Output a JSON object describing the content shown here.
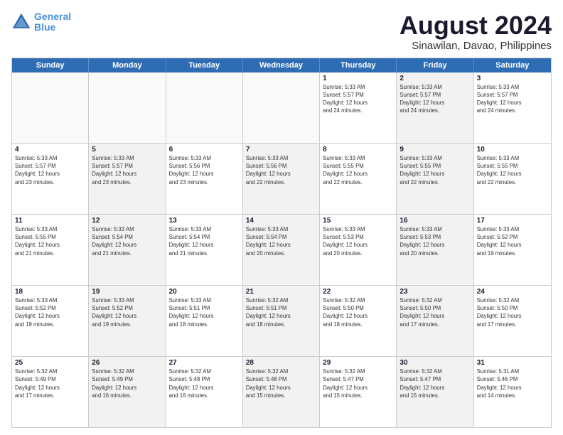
{
  "logo": {
    "line1": "General",
    "line2": "Blue"
  },
  "title": "August 2024",
  "subtitle": "Sinawilan, Davao, Philippines",
  "header_days": [
    "Sunday",
    "Monday",
    "Tuesday",
    "Wednesday",
    "Thursday",
    "Friday",
    "Saturday"
  ],
  "weeks": [
    [
      {
        "day": "",
        "info": "",
        "empty": true
      },
      {
        "day": "",
        "info": "",
        "empty": true
      },
      {
        "day": "",
        "info": "",
        "empty": true
      },
      {
        "day": "",
        "info": "",
        "empty": true
      },
      {
        "day": "1",
        "info": "Sunrise: 5:33 AM\nSunset: 5:57 PM\nDaylight: 12 hours\nand 24 minutes.",
        "empty": false,
        "shaded": false
      },
      {
        "day": "2",
        "info": "Sunrise: 5:33 AM\nSunset: 5:57 PM\nDaylight: 12 hours\nand 24 minutes.",
        "empty": false,
        "shaded": true
      },
      {
        "day": "3",
        "info": "Sunrise: 5:33 AM\nSunset: 5:57 PM\nDaylight: 12 hours\nand 24 minutes.",
        "empty": false,
        "shaded": false
      }
    ],
    [
      {
        "day": "4",
        "info": "Sunrise: 5:33 AM\nSunset: 5:57 PM\nDaylight: 12 hours\nand 23 minutes.",
        "empty": false,
        "shaded": false
      },
      {
        "day": "5",
        "info": "Sunrise: 5:33 AM\nSunset: 5:57 PM\nDaylight: 12 hours\nand 23 minutes.",
        "empty": false,
        "shaded": true
      },
      {
        "day": "6",
        "info": "Sunrise: 5:33 AM\nSunset: 5:56 PM\nDaylight: 12 hours\nand 23 minutes.",
        "empty": false,
        "shaded": false
      },
      {
        "day": "7",
        "info": "Sunrise: 5:33 AM\nSunset: 5:56 PM\nDaylight: 12 hours\nand 22 minutes.",
        "empty": false,
        "shaded": true
      },
      {
        "day": "8",
        "info": "Sunrise: 5:33 AM\nSunset: 5:55 PM\nDaylight: 12 hours\nand 22 minutes.",
        "empty": false,
        "shaded": false
      },
      {
        "day": "9",
        "info": "Sunrise: 5:33 AM\nSunset: 5:55 PM\nDaylight: 12 hours\nand 22 minutes.",
        "empty": false,
        "shaded": true
      },
      {
        "day": "10",
        "info": "Sunrise: 5:33 AM\nSunset: 5:55 PM\nDaylight: 12 hours\nand 22 minutes.",
        "empty": false,
        "shaded": false
      }
    ],
    [
      {
        "day": "11",
        "info": "Sunrise: 5:33 AM\nSunset: 5:55 PM\nDaylight: 12 hours\nand 21 minutes.",
        "empty": false,
        "shaded": false
      },
      {
        "day": "12",
        "info": "Sunrise: 5:33 AM\nSunset: 5:54 PM\nDaylight: 12 hours\nand 21 minutes.",
        "empty": false,
        "shaded": true
      },
      {
        "day": "13",
        "info": "Sunrise: 5:33 AM\nSunset: 5:54 PM\nDaylight: 12 hours\nand 21 minutes.",
        "empty": false,
        "shaded": false
      },
      {
        "day": "14",
        "info": "Sunrise: 5:33 AM\nSunset: 5:54 PM\nDaylight: 12 hours\nand 20 minutes.",
        "empty": false,
        "shaded": true
      },
      {
        "day": "15",
        "info": "Sunrise: 5:33 AM\nSunset: 5:53 PM\nDaylight: 12 hours\nand 20 minutes.",
        "empty": false,
        "shaded": false
      },
      {
        "day": "16",
        "info": "Sunrise: 5:33 AM\nSunset: 5:53 PM\nDaylight: 12 hours\nand 20 minutes.",
        "empty": false,
        "shaded": true
      },
      {
        "day": "17",
        "info": "Sunrise: 5:33 AM\nSunset: 5:52 PM\nDaylight: 12 hours\nand 19 minutes.",
        "empty": false,
        "shaded": false
      }
    ],
    [
      {
        "day": "18",
        "info": "Sunrise: 5:33 AM\nSunset: 5:52 PM\nDaylight: 12 hours\nand 19 minutes.",
        "empty": false,
        "shaded": false
      },
      {
        "day": "19",
        "info": "Sunrise: 5:33 AM\nSunset: 5:52 PM\nDaylight: 12 hours\nand 19 minutes.",
        "empty": false,
        "shaded": true
      },
      {
        "day": "20",
        "info": "Sunrise: 5:33 AM\nSunset: 5:51 PM\nDaylight: 12 hours\nand 18 minutes.",
        "empty": false,
        "shaded": false
      },
      {
        "day": "21",
        "info": "Sunrise: 5:32 AM\nSunset: 5:51 PM\nDaylight: 12 hours\nand 18 minutes.",
        "empty": false,
        "shaded": true
      },
      {
        "day": "22",
        "info": "Sunrise: 5:32 AM\nSunset: 5:50 PM\nDaylight: 12 hours\nand 18 minutes.",
        "empty": false,
        "shaded": false
      },
      {
        "day": "23",
        "info": "Sunrise: 5:32 AM\nSunset: 5:50 PM\nDaylight: 12 hours\nand 17 minutes.",
        "empty": false,
        "shaded": true
      },
      {
        "day": "24",
        "info": "Sunrise: 5:32 AM\nSunset: 5:50 PM\nDaylight: 12 hours\nand 17 minutes.",
        "empty": false,
        "shaded": false
      }
    ],
    [
      {
        "day": "25",
        "info": "Sunrise: 5:32 AM\nSunset: 5:49 PM\nDaylight: 12 hours\nand 17 minutes.",
        "empty": false,
        "shaded": false
      },
      {
        "day": "26",
        "info": "Sunrise: 5:32 AM\nSunset: 5:49 PM\nDaylight: 12 hours\nand 16 minutes.",
        "empty": false,
        "shaded": true
      },
      {
        "day": "27",
        "info": "Sunrise: 5:32 AM\nSunset: 5:48 PM\nDaylight: 12 hours\nand 16 minutes.",
        "empty": false,
        "shaded": false
      },
      {
        "day": "28",
        "info": "Sunrise: 5:32 AM\nSunset: 5:48 PM\nDaylight: 12 hours\nand 15 minutes.",
        "empty": false,
        "shaded": true
      },
      {
        "day": "29",
        "info": "Sunrise: 5:32 AM\nSunset: 5:47 PM\nDaylight: 12 hours\nand 15 minutes.",
        "empty": false,
        "shaded": false
      },
      {
        "day": "30",
        "info": "Sunrise: 5:32 AM\nSunset: 5:47 PM\nDaylight: 12 hours\nand 15 minutes.",
        "empty": false,
        "shaded": true
      },
      {
        "day": "31",
        "info": "Sunrise: 5:31 AM\nSunset: 5:46 PM\nDaylight: 12 hours\nand 14 minutes.",
        "empty": false,
        "shaded": false
      }
    ]
  ]
}
